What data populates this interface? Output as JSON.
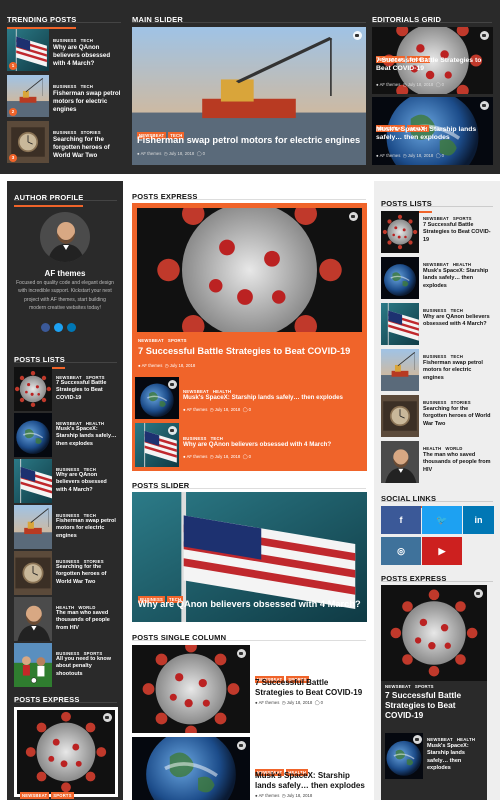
{
  "colors": {
    "accent": "#f0642a",
    "dark": "#2a2a2a",
    "facebook": "#3b5998",
    "twitter": "#1da1f2",
    "linkedin": "#0077b5",
    "instagram": "#3f729b",
    "youtube": "#cd201f"
  },
  "top": {
    "trending": {
      "title": "Trending Posts",
      "items": [
        {
          "cats": [
            "Business",
            "Tech"
          ],
          "title": "Why are QAnon believers obsessed with 4 March?",
          "num": "1"
        },
        {
          "cats": [
            "Business",
            "Tech"
          ],
          "title": "Fisherman swap petrol motors for electric engines",
          "num": "2"
        },
        {
          "cats": [
            "Business",
            "Stories"
          ],
          "title": "Searching for the forgotten heroes of World War Two",
          "num": "3"
        }
      ]
    },
    "slider": {
      "title": "Main Slider",
      "cats": [
        "Newsbeat",
        "Tech"
      ],
      "headline": "Fisherman swap petrol motors for electric engines",
      "author": "AF themes",
      "date": "July 18, 2018",
      "comments": "0"
    },
    "editorials": {
      "title": "Editorials Grid",
      "items": [
        {
          "cats": [
            "Newsbeat",
            "Sports"
          ],
          "title": "7 Successful Battle Strategies to Beat COVID-19",
          "author": "AF themes",
          "date": "July 18, 2018",
          "comments": "0"
        },
        {
          "cats": [
            "Newsbeat",
            "Health"
          ],
          "title": "Musk's SpaceX: Starship lands safely… then explodes",
          "author": "AF themes",
          "date": "July 18, 2018",
          "comments": "0"
        }
      ]
    }
  },
  "left": {
    "author_profile": {
      "title": "Author Profile",
      "name": "AF themes",
      "bio": "Focused on quality code and elegant design with incredible support. Kickstart your next project with AF themes, start building modern creative websites today!"
    },
    "posts_lists": {
      "title": "Posts Lists",
      "items": [
        {
          "cats": [
            "Newsbeat",
            "Sports"
          ],
          "title": "7 Successful Battle Strategies to Beat COVID-19"
        },
        {
          "cats": [
            "Newsbeat",
            "Health"
          ],
          "title": "Musk's SpaceX: Starship lands safely… then explodes"
        },
        {
          "cats": [
            "Business",
            "Tech"
          ],
          "title": "Why are QAnon believers obsessed with 4 March?"
        },
        {
          "cats": [
            "Business",
            "Tech"
          ],
          "title": "Fisherman swap petrol motors for electric engines"
        },
        {
          "cats": [
            "Business",
            "Stories"
          ],
          "title": "Searching for the forgotten heroes of World War Two"
        },
        {
          "cats": [
            "Health",
            "World"
          ],
          "title": "The man who saved thousands of people from HIV"
        },
        {
          "cats": [
            "Business",
            "Sports"
          ],
          "title": "All you need to know about penalty shootouts"
        }
      ]
    },
    "posts_express": {
      "title": "Posts Express",
      "cats": [
        "Newsbeat",
        "Sports"
      ]
    }
  },
  "center": {
    "posts_express": {
      "title": "Posts Express",
      "main": {
        "cats": [
          "Newsbeat",
          "Sports"
        ],
        "title": "7 Successful Battle Strategies to Beat COVID-19",
        "author": "AF themes",
        "date": "July 18, 2018",
        "comments": "0"
      },
      "items": [
        {
          "cats": [
            "Newsbeat",
            "Health"
          ],
          "title": "Musk's SpaceX: Starship lands safely… then explodes",
          "author": "AF themes",
          "date": "July 18, 2018",
          "comments": "0"
        },
        {
          "cats": [
            "Business",
            "Tech"
          ],
          "title": "Why are QAnon believers obsessed with 4 March?",
          "author": "AF themes",
          "date": "July 18, 2018",
          "comments": "0"
        }
      ]
    },
    "posts_slider": {
      "title": "Posts Slider",
      "cats": [
        "Business",
        "Tech"
      ],
      "headline": "Why are QAnon believers obsessed with 4 March?"
    },
    "single_column": {
      "title": "Posts Single Column",
      "items": [
        {
          "cats": [
            "Newsbeat",
            "Sports"
          ],
          "title": "7 Successful Battle Strategies to Beat COVID-19",
          "author": "AF themes",
          "date": "July 18, 2018",
          "comments": "0"
        },
        {
          "cats": [
            "Newsbeat",
            "Health"
          ],
          "title": "Musk's SpaceX: Starship lands safely… then explodes",
          "author": "AF themes",
          "date": "July 18, 2018"
        }
      ]
    }
  },
  "right": {
    "posts_lists": {
      "title": "Posts Lists",
      "items": [
        {
          "cats": [
            "Newsbeat",
            "Sports"
          ],
          "title": "7 Successful Battle Strategies to Beat COVID-19"
        },
        {
          "cats": [
            "Newsbeat",
            "Health"
          ],
          "title": "Musk's SpaceX: Starship lands safely… then explodes"
        },
        {
          "cats": [
            "Business",
            "Tech"
          ],
          "title": "Why are QAnon believers obsessed with 4 March?"
        },
        {
          "cats": [
            "Business",
            "Tech"
          ],
          "title": "Fisherman swap petrol motors for electric engines"
        },
        {
          "cats": [
            "Business",
            "Stories"
          ],
          "title": "Searching for the forgotten heroes of World War Two"
        },
        {
          "cats": [
            "Health",
            "World"
          ],
          "title": "The man who saved thousands of people from HIV"
        }
      ]
    },
    "social": {
      "title": "Social Links",
      "icons": [
        "facebook-icon",
        "twitter-icon",
        "linkedin-icon",
        "instagram-icon",
        "youtube-icon"
      ]
    },
    "posts_express": {
      "title": "Posts Express",
      "main": {
        "cats": [
          "Newsbeat",
          "Sports"
        ],
        "title": "7 Successful Battle Strategies to Beat COVID-19"
      },
      "item": {
        "cats": [
          "Newsbeat",
          "Health"
        ],
        "title": "Musk's SpaceX: Starship lands safely… then explodes"
      }
    }
  }
}
